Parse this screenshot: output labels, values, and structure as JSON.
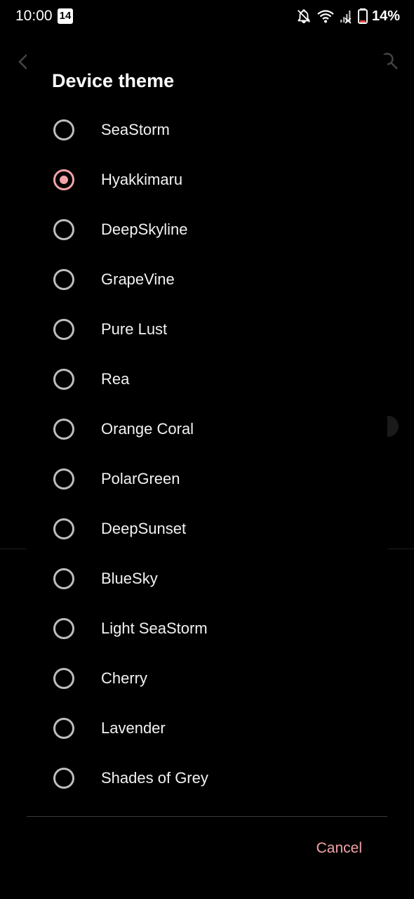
{
  "status_bar": {
    "time": "10:00",
    "calendar_badge": "14",
    "battery_percent": "14%",
    "icons": [
      "notifications-off-icon",
      "wifi-icon",
      "signal-no-service-icon",
      "battery-icon"
    ]
  },
  "background": {
    "back_icon": "arrow-back-icon",
    "search_icon": "search-icon"
  },
  "dialog": {
    "title": "Device theme",
    "options": [
      {
        "label": "SeaStorm",
        "selected": false
      },
      {
        "label": "Hyakkimaru",
        "selected": true
      },
      {
        "label": "DeepSkyline",
        "selected": false
      },
      {
        "label": "GrapeVine",
        "selected": false
      },
      {
        "label": "Pure Lust",
        "selected": false
      },
      {
        "label": "Rea",
        "selected": false
      },
      {
        "label": "Orange Coral",
        "selected": false
      },
      {
        "label": "PolarGreen",
        "selected": false
      },
      {
        "label": "DeepSunset",
        "selected": false
      },
      {
        "label": "BlueSky",
        "selected": false
      },
      {
        "label": "Light SeaStorm",
        "selected": false
      },
      {
        "label": "Cherry",
        "selected": false
      },
      {
        "label": "Lavender",
        "selected": false
      },
      {
        "label": "Shades of Grey",
        "selected": false
      }
    ],
    "cancel_label": "Cancel"
  },
  "colors": {
    "accent": "#f1a3a8",
    "background": "#000000",
    "radio_unchecked": "#bdbdbd"
  }
}
